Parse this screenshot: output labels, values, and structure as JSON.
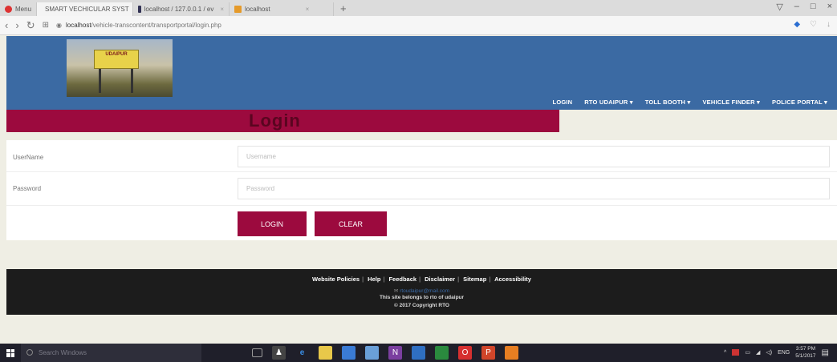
{
  "browser": {
    "tabs": [
      {
        "label": "Menu",
        "color": "#d33"
      },
      {
        "label": "SMART VECHICULAR SYST",
        "color": "#e59a2a"
      },
      {
        "label": "localhost / 127.0.0.1 / ev",
        "color": "#335"
      },
      {
        "label": "localhost",
        "color": "#e59a2a"
      }
    ],
    "url_host": "localhost",
    "url_path": "/vehicle-transcontent/transportportal/login.php"
  },
  "header": {
    "logo_text": "UDAIPUR",
    "nav": [
      "LOGIN",
      "RTO UDAIPUR ▾",
      "TOLL BOOTH ▾",
      "VEHICLE FINDER ▾",
      "POLICE PORTAL ▾"
    ]
  },
  "login": {
    "title": "Login",
    "username_label": "UserName",
    "username_placeholder": "Username",
    "password_label": "Password",
    "password_placeholder": "Password",
    "login_button": "LOGIN",
    "clear_button": "CLEAR"
  },
  "footer": {
    "links": [
      "Website Policies",
      "Help",
      "Feedback",
      "Disclaimer",
      "Sitemap",
      "Accessibility"
    ],
    "email": "rtoudaipur@mail.com",
    "belongs": "This site belongs to rto of udaipur",
    "copyright": "© 2017 Copyright RTO"
  },
  "taskbar": {
    "search_placeholder": "Search Windows",
    "time": "3:57 PM",
    "date": "5/1/2017",
    "lang": "ENG"
  },
  "colors": {
    "header_blue": "#3b6aa3",
    "maroon": "#9c0a3e",
    "footer_dark": "#1c1c1c"
  }
}
